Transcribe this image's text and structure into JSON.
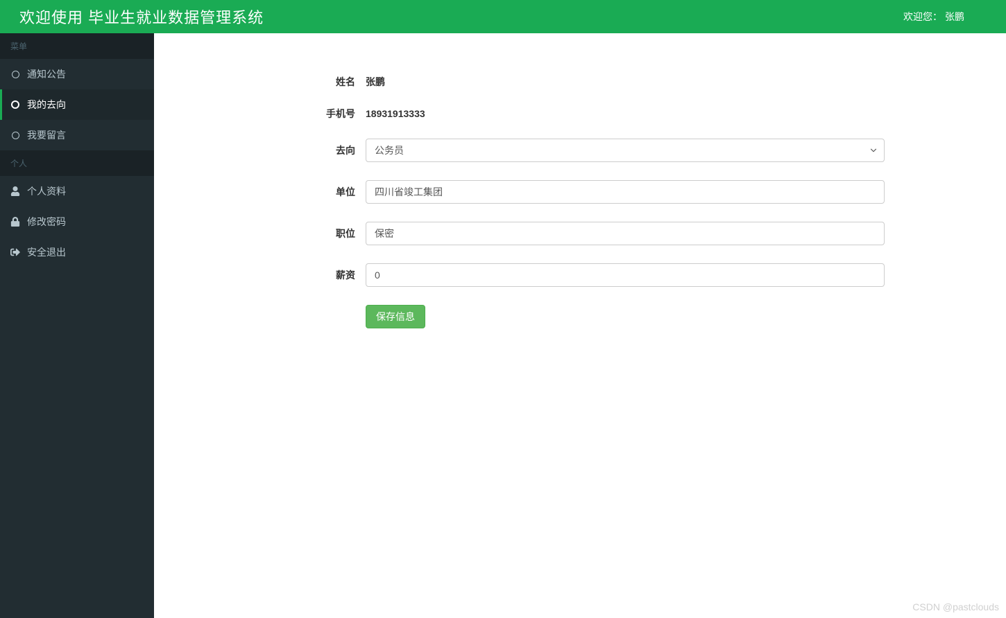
{
  "header": {
    "title": "欢迎使用 毕业生就业数据管理系统",
    "welcome_prefix": "欢迎您：",
    "username": "张鹏"
  },
  "sidebar": {
    "menu_header": "菜单",
    "personal_header": "个人",
    "items": {
      "notice": "通知公告",
      "my_destination": "我的去向",
      "feedback": "我要留言",
      "profile": "个人资料",
      "change_password": "修改密码",
      "logout": "安全退出"
    }
  },
  "form": {
    "labels": {
      "name": "姓名",
      "phone": "手机号",
      "destination": "去向",
      "company": "单位",
      "position": "职位",
      "salary": "薪资"
    },
    "values": {
      "name": "张鹏",
      "phone": "18931913333",
      "destination": "公务员",
      "company": "四川省竣工集团",
      "position": "保密",
      "salary": "0"
    },
    "save_button": "保存信息"
  },
  "watermark": "CSDN @pastclouds"
}
